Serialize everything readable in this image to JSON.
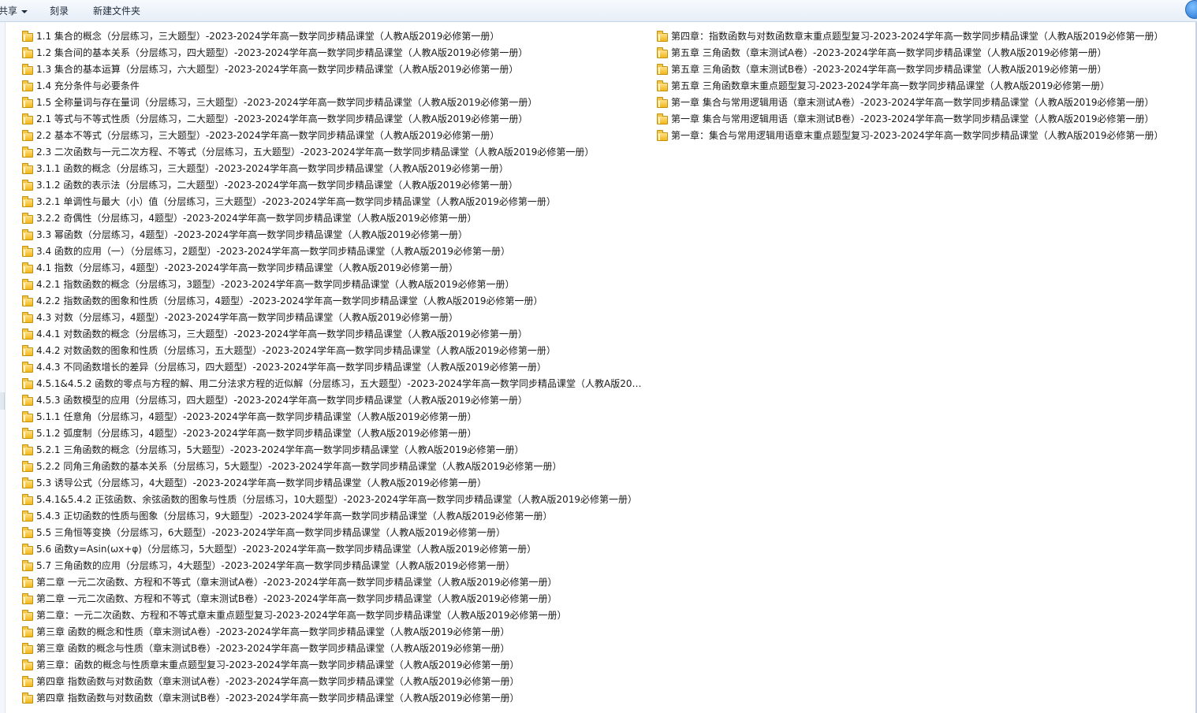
{
  "toolbar": {
    "share_label": "共享",
    "burn_label": "刻录",
    "new_folder_label": "新建文件夹"
  },
  "icons": {
    "folder": "folder-icon",
    "share_dropdown": "chevron-down-icon",
    "help": "help-icon"
  },
  "files": {
    "column1": [
      "1.1 集合的概念（分层练习，三大题型）-2023-2024学年高一数学同步精品课堂（人教A版2019必修第一册）",
      "1.2 集合间的基本关系（分层练习，四大题型）-2023-2024学年高一数学同步精品课堂（人教A版2019必修第一册）",
      "1.3 集合的基本运算（分层练习，六大题型）-2023-2024学年高一数学同步精品课堂（人教A版2019必修第一册）",
      "1.4 充分条件与必要条件",
      "1.5 全称量词与存在量词（分层练习，三大题型）-2023-2024学年高一数学同步精品课堂（人教A版2019必修第一册）",
      "2.1 等式与不等式性质（分层练习，二大题型）-2023-2024学年高一数学同步精品课堂（人教A版2019必修第一册）",
      "2.2 基本不等式（分层练习，三大题型）-2023-2024学年高一数学同步精品课堂（人教A版2019必修第一册）",
      "2.3 二次函数与一元二次方程、不等式（分层练习，五大题型）-2023-2024学年高一数学同步精品课堂（人教A版2019必修第一册）",
      "3.1.1 函数的概念（分层练习，三大题型）-2023-2024学年高一数学同步精品课堂（人教A版2019必修第一册）",
      "3.1.2 函数的表示法（分层练习，二大题型）-2023-2024学年高一数学同步精品课堂（人教A版2019必修第一册）",
      "3.2.1 单调性与最大（小）值（分层练习，三大题型）-2023-2024学年高一数学同步精品课堂（人教A版2019必修第一册）",
      "3.2.2 奇偶性（分层练习，4题型）-2023-2024学年高一数学同步精品课堂（人教A版2019必修第一册）",
      "3.3 幂函数（分层练习，4题型）-2023-2024学年高一数学同步精品课堂（人教A版2019必修第一册）",
      "3.4 函数的应用（一）（分层练习，2题型）-2023-2024学年高一数学同步精品课堂（人教A版2019必修第一册）",
      "4.1 指数（分层练习，4题型）-2023-2024学年高一数学同步精品课堂（人教A版2019必修第一册）",
      "4.2.1 指数函数的概念（分层练习，3题型）-2023-2024学年高一数学同步精品课堂（人教A版2019必修第一册）",
      "4.2.2 指数函数的图象和性质（分层练习，4题型）-2023-2024学年高一数学同步精品课堂（人教A版2019必修第一册）",
      "4.3 对数（分层练习，4题型）-2023-2024学年高一数学同步精品课堂（人教A版2019必修第一册）",
      "4.4.1 对数函数的概念（分层练习，三大题型）-2023-2024学年高一数学同步精品课堂（人教A版2019必修第一册）",
      "4.4.2 对数函数的图象和性质（分层练习，五大题型）-2023-2024学年高一数学同步精品课堂（人教A版2019必修第一册）",
      "4.4.3 不同函数增长的差异（分层练习，四大题型）-2023-2024学年高一数学同步精品课堂（人教A版2019必修第一册）",
      "4.5.1&4.5.2 函数的零点与方程的解、用二分法求方程的近似解（分层练习，五大题型）-2023-2024学年高一数学同步精品课堂（人教A版2019...",
      "4.5.3 函数模型的应用（分层练习，四大题型）-2023-2024学年高一数学同步精品课堂（人教A版2019必修第一册）",
      "5.1.1 任意角（分层练习，4题型）-2023-2024学年高一数学同步精品课堂（人教A版2019必修第一册）",
      "5.1.2 弧度制（分层练习，4题型）-2023-2024学年高一数学同步精品课堂（人教A版2019必修第一册）",
      "5.2.1 三角函数的概念（分层练习，5大题型）-2023-2024学年高一数学同步精品课堂（人教A版2019必修第一册）",
      "5.2.2 同角三角函数的基本关系（分层练习，5大题型）-2023-2024学年高一数学同步精品课堂（人教A版2019必修第一册）",
      "5.3 诱导公式（分层练习，4大题型）-2023-2024学年高一数学同步精品课堂（人教A版2019必修第一册）",
      "5.4.1&5.4.2 正弦函数、余弦函数的图象与性质（分层练习，10大题型）-2023-2024学年高一数学同步精品课堂（人教A版2019必修第一册）",
      "5.4.3 正切函数的性质与图象（分层练习，9大题型）-2023-2024学年高一数学同步精品课堂（人教A版2019必修第一册）",
      "5.5 三角恒等变换（分层练习，6大题型）-2023-2024学年高一数学同步精品课堂（人教A版2019必修第一册）",
      "5.6 函数y=Asin(ωx+φ)（分层练习，5大题型）-2023-2024学年高一数学同步精品课堂（人教A版2019必修第一册）",
      "5.7 三角函数的应用（分层练习，4大题型）-2023-2024学年高一数学同步精品课堂（人教A版2019必修第一册）",
      "第二章 一元二次函数、方程和不等式（章末测试A卷）-2023-2024学年高一数学同步精品课堂（人教A版2019必修第一册）",
      "第二章 一元二次函数、方程和不等式（章末测试B卷）-2023-2024学年高一数学同步精品课堂（人教A版2019必修第一册）",
      "第二章：一元二次函数、方程和不等式章末重点题型复习-2023-2024学年高一数学同步精品课堂（人教A版2019必修第一册）",
      "第三章 函数的概念和性质（章末测试A卷）-2023-2024学年高一数学同步精品课堂（人教A版2019必修第一册）",
      "第三章 函数的概念与性质（章末测试B卷）-2023-2024学年高一数学同步精品课堂（人教A版2019必修第一册）",
      "第三章：函数的概念与性质章末重点题型复习-2023-2024学年高一数学同步精品课堂（人教A版2019必修第一册）",
      "第四章 指数函数与对数函数（章末测试A卷）-2023-2024学年高一数学同步精品课堂（人教A版2019必修第一册）",
      "第四章 指数函数与对数函数（章末测试B卷）-2023-2024学年高一数学同步精品课堂（人教A版2019必修第一册）"
    ],
    "column2": [
      "第四章：指数函数与对数函数章末重点题型复习-2023-2024学年高一数学同步精品课堂（人教A版2019必修第一册）",
      "第五章 三角函数（章末测试A卷）-2023-2024学年高一数学同步精品课堂（人教A版2019必修第一册）",
      "第五章 三角函数（章末测试B卷）-2023-2024学年高一数学同步精品课堂（人教A版2019必修第一册）",
      "第五章 三角函数章末重点题型复习-2023-2024学年高一数学同步精品课堂（人教A版2019必修第一册）",
      "第一章 集合与常用逻辑用语（章末测试A卷）-2023-2024学年高一数学同步精品课堂（人教A版2019必修第一册）",
      "第一章 集合与常用逻辑用语（章末测试B卷）-2023-2024学年高一数学同步精品课堂（人教A版2019必修第一册）",
      "第一章：集合与常用逻辑用语章末重点题型复习-2023-2024学年高一数学同步精品课堂（人教A版2019必修第一册）"
    ]
  }
}
